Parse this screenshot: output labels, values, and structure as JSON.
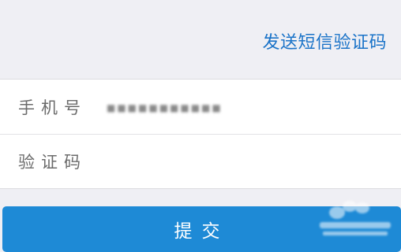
{
  "header": {
    "send_sms_label": "发送短信验证码"
  },
  "form": {
    "phone_label": "手机号",
    "phone_value": "■■■■■■■■■■■",
    "code_label": "验证码",
    "code_value": ""
  },
  "submit": {
    "label": "提交"
  },
  "colors": {
    "accent": "#1e8ad6",
    "link": "#1a73c8",
    "background": "#efeff4"
  }
}
